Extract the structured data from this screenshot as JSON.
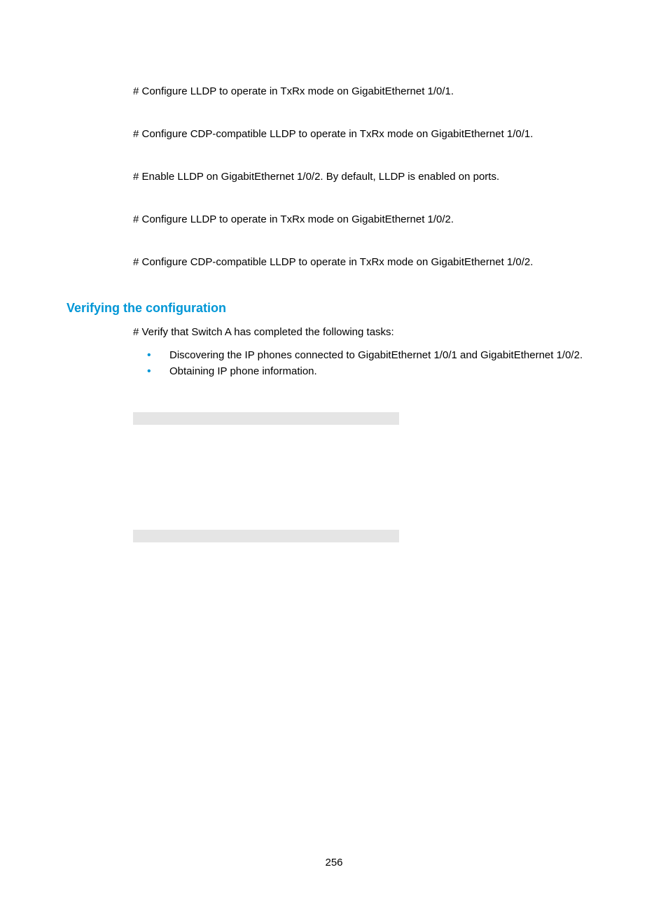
{
  "steps": {
    "step1": "# Configure LLDP to operate in TxRx mode on GigabitEthernet 1/0/1.",
    "step2": "# Configure CDP-compatible LLDP to operate in TxRx mode on GigabitEthernet 1/0/1.",
    "step3": "# Enable LLDP on GigabitEthernet 1/0/2. By default, LLDP is enabled on ports.",
    "step4": "# Configure LLDP to operate in TxRx mode on GigabitEthernet 1/0/2.",
    "step5": "# Configure CDP-compatible LLDP to operate in TxRx mode on GigabitEthernet 1/0/2."
  },
  "section": {
    "heading": "Verifying the configuration",
    "intro": "# Verify that Switch A has completed the following tasks:",
    "bullets": [
      "Discovering the IP phones connected to GigabitEthernet 1/0/1 and GigabitEthernet 1/0/2.",
      "Obtaining IP phone information."
    ]
  },
  "pageNumber": "256"
}
